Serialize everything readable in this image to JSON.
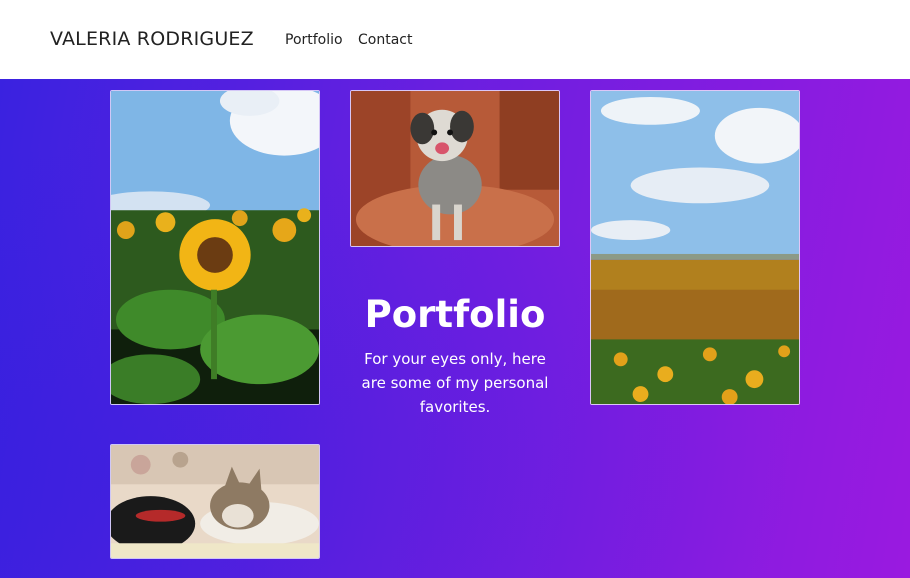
{
  "header": {
    "brand": "VALERIA RODRIGUEZ",
    "nav": [
      {
        "label": "Portfolio"
      },
      {
        "label": "Contact"
      }
    ]
  },
  "hero": {
    "title": "Portfolio",
    "subtitle": "For your eyes only, here are some of my personal favorites."
  },
  "gallery": [
    {
      "subject": "sunflower-close-up"
    },
    {
      "subject": "dog-on-red-rocks"
    },
    {
      "subject": "sunflower-field-horizon"
    },
    {
      "subject": "sleeping-tabby-cat"
    }
  ],
  "colors": {
    "gradient_start": "#3a22e0",
    "gradient_end": "#9a1ae0",
    "nav_background": "#ffffff"
  }
}
